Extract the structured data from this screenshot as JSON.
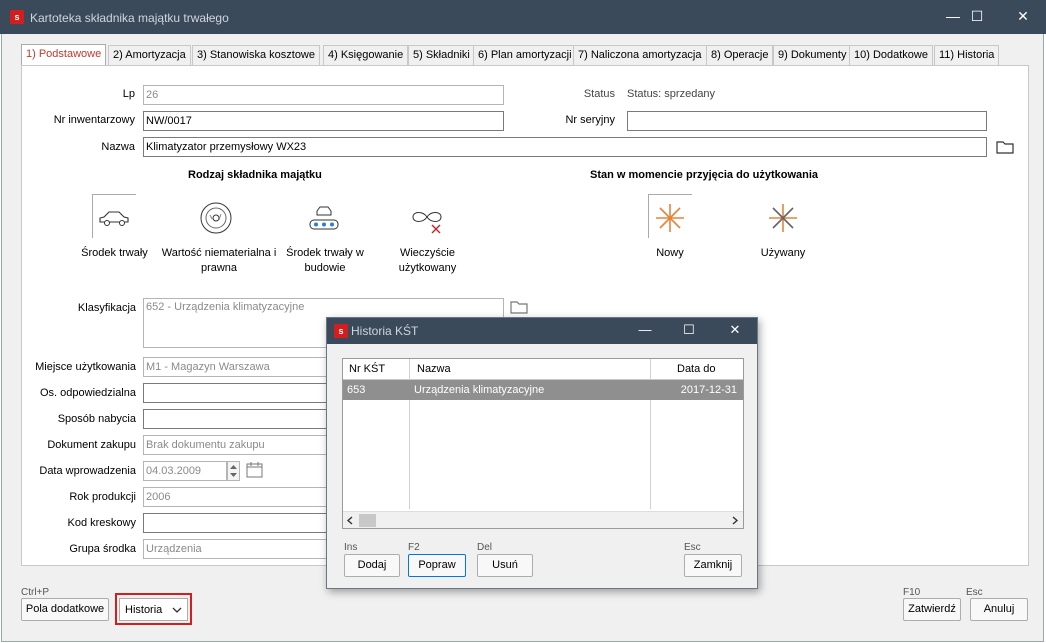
{
  "window": {
    "title": "Kartoteka składnika majątku trwałego",
    "icon_letter": "s",
    "minimize": "—",
    "maximize": "☐",
    "close": "✕"
  },
  "tabs": [
    {
      "label": "1) Podstawowe",
      "active": true
    },
    {
      "label": "2) Amortyzacja"
    },
    {
      "label": "3) Stanowiska kosztowe"
    },
    {
      "label": "4) Księgowanie"
    },
    {
      "label": "5) Składniki"
    },
    {
      "label": "6) Plan amortyzacji"
    },
    {
      "label": "7) Naliczona amortyzacja"
    },
    {
      "label": "8) Operacje"
    },
    {
      "label": "9) Dokumenty"
    },
    {
      "label": "10) Dodatkowe"
    },
    {
      "label": "11) Historia"
    }
  ],
  "form": {
    "lp_label": "Lp",
    "lp_value": "26",
    "status_label": "Status",
    "status_value": "Status: sprzedany",
    "inv_label": "Nr inwentarzowy",
    "inv_value": "NW/0017",
    "serial_label": "Nr seryjny",
    "serial_value": "",
    "name_label": "Nazwa",
    "name_value": "Klimatyzator przemysłowy WX23",
    "kind_title": "Rodzaj składnika majątku",
    "kinds": [
      {
        "label": "Środek trwały"
      },
      {
        "label": "Wartość niematerialna i prawna"
      },
      {
        "label": "Środek trwały w budowie"
      },
      {
        "label": "Wieczyście użytkowany"
      }
    ],
    "state_title": "Stan w momencie przyjęcia do użytkowania",
    "states": [
      {
        "label": "Nowy"
      },
      {
        "label": "Używany"
      }
    ],
    "klas_label": "Klasyfikacja",
    "klas_value": "652 - Urządzenia klimatyzacyjne",
    "place_label": "Miejsce użytkowania",
    "place_value": "M1 - Magazyn Warszawa",
    "resp_label": "Os. odpowiedzialna",
    "resp_value": "",
    "acq_label": "Sposób nabycia",
    "acq_value": "",
    "doc_label": "Dokument zakupu",
    "doc_value": "Brak dokumentu zakupu",
    "date_label": "Data wprowadzenia",
    "date_value": "04.03.2009",
    "year_label": "Rok produkcji",
    "year_value": "2006",
    "barcode_label": "Kod kreskowy",
    "barcode_value": "",
    "group_label": "Grupa środka",
    "group_value": "Urządzenia"
  },
  "footer": {
    "extra_key": "Ctrl+P",
    "extra_label": "Pola dodatkowe",
    "history_label": "Historia",
    "confirm_key": "F10",
    "confirm_label": "Zatwierdź",
    "cancel_key": "Esc",
    "cancel_label": "Anuluj",
    "highlight_color": "#d11e1e"
  },
  "dialog": {
    "title": "Historia KŚT",
    "columns": [
      "Nr KŚT",
      "Nazwa",
      "Data do"
    ],
    "rows": [
      {
        "nr": "653",
        "name": "Urządzenia klimatyzacyjne",
        "date": "2017-12-31"
      }
    ],
    "add_key": "Ins",
    "add_label": "Dodaj",
    "edit_key": "F2",
    "edit_label": "Popraw",
    "del_key": "Del",
    "del_label": "Usuń",
    "close_key": "Esc",
    "close_label": "Zamknij"
  },
  "colors": {
    "titlebar": "#3b4a5a",
    "active_tab": "#c0392b",
    "selected_row": "#8f8f8f",
    "icon_orange": "#e8833a"
  }
}
